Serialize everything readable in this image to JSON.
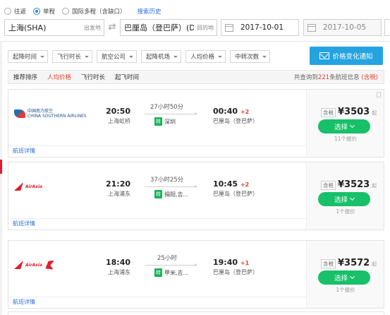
{
  "trip_types": [
    {
      "label": "往返",
      "selected": false
    },
    {
      "label": "单程",
      "selected": true
    },
    {
      "label": "国际多程（含缺口）",
      "selected": false
    }
  ],
  "search_history": "搜索历史",
  "from": {
    "value": "上海(SHA)",
    "hint": "出发地"
  },
  "to": {
    "value": "巴厘岛（登巴萨）(DP",
    "hint": "目的地"
  },
  "depart_date": "2017-10-01",
  "return_date": "2017-10-05",
  "filters": [
    "起降时间",
    "飞行时长",
    "航空公司",
    "起降机场",
    "人均价格",
    "中转次数"
  ],
  "notify_button": "价格变化通知",
  "sort_tabs": [
    "推荐排序",
    "人均价格",
    "飞行时长",
    "起飞时间"
  ],
  "result_summary": {
    "prefix": "共查询到",
    "count": "221",
    "suffix": "条航班信息",
    "tax_note": "(含税)"
  },
  "flights": [
    {
      "airline_logo": "china-southern-logo",
      "airline_text": "中国南方航空\nCHINA SOUTHERN AIRLINES",
      "dep_time": "20:50",
      "dep_airport": "上海虹桥",
      "duration": "27小时50分",
      "stop_badge": "转",
      "stop_city": "深圳",
      "arr_time": "00:40",
      "arr_plus": "+2",
      "arr_airport": "巴厘岛（登巴萨）",
      "tax_label": "含税",
      "price": "¥3503",
      "price_suffix": "起",
      "select_label": "选择",
      "quote_count": "11个报价",
      "detail_link": "航班详情"
    },
    {
      "airline_logo": "airasia-logo",
      "airline_text": "AirAsia",
      "dep_time": "21:20",
      "dep_airport": "上海浦东",
      "duration": "37小时25分",
      "stop_badge": "转",
      "stop_city": "揭阳,吉...",
      "arr_time": "10:45",
      "arr_plus": "+2",
      "arr_airport": "巴厘岛（登巴萨）",
      "tax_label": "含税",
      "price": "¥3523",
      "price_suffix": "起",
      "select_label": "选择",
      "quote_count": "1个报价",
      "detail_link": "航班详情"
    },
    {
      "airline_logo": "airasia-multi-logo",
      "airline_text": "AirAsia",
      "dep_time": "18:40",
      "dep_airport": "上海浦东",
      "duration": "25小时",
      "stop_badge": "转",
      "stop_city": "甲米,吉...",
      "arr_time": "19:40",
      "arr_plus": "+1",
      "arr_airport": "巴厘岛（登巴萨）",
      "tax_label": "含税",
      "price": "¥3572",
      "price_suffix": "起",
      "select_label": "选择",
      "quote_count": "1个报价",
      "detail_link": "航班详情"
    }
  ],
  "colors": {
    "accent_blue": "#24a3e0",
    "select_green": "#17c069",
    "price_red": "#e2412c",
    "link_blue": "#2a6fd6"
  }
}
